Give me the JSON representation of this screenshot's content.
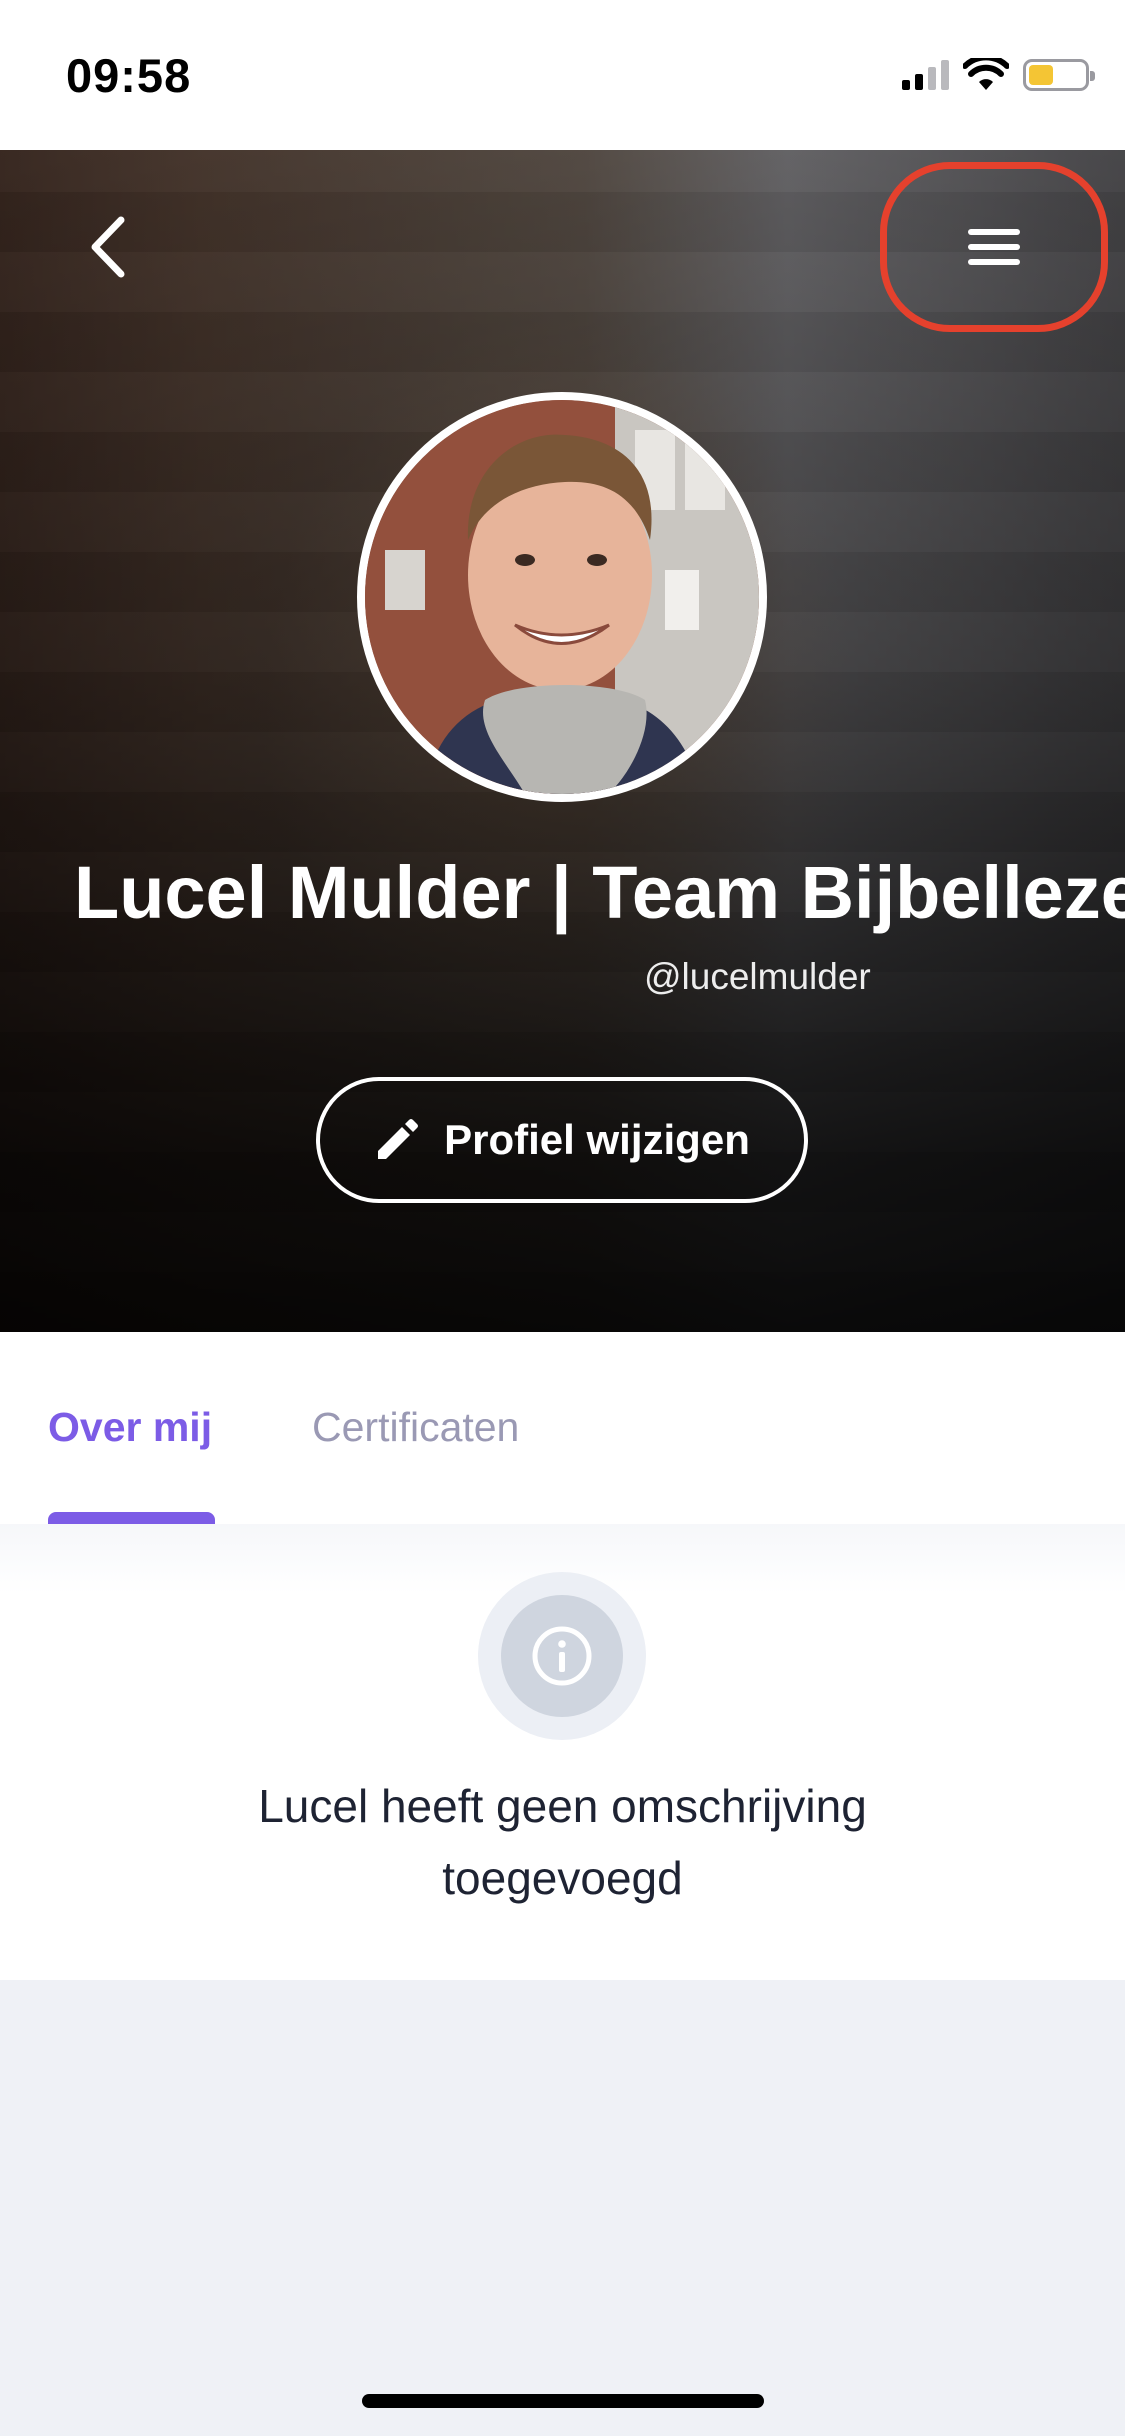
{
  "status_bar": {
    "time": "09:58",
    "signal_icon": "signal-bars-icon",
    "wifi_icon": "wifi-icon",
    "battery_icon": "battery-icon",
    "battery_color": "#f4c534"
  },
  "header": {
    "back_icon": "chevron-left-icon",
    "menu_icon": "hamburger-menu-icon",
    "highlight_color": "#e5412d"
  },
  "profile": {
    "name": "Lucel Mulder | Team Bijbellezen",
    "handle": "@lucelmulder",
    "edit_button_label": "Profiel wijzigen",
    "edit_icon": "pencil-icon"
  },
  "tabs": [
    {
      "label": "Over mij",
      "active": true
    },
    {
      "label": "Certificaten",
      "active": false
    }
  ],
  "accent_color": "#7c5ce6",
  "about": {
    "info_icon": "info-icon",
    "empty_line1": "Lucel heeft geen omschrijving",
    "empty_line2": "toegevoegd"
  }
}
